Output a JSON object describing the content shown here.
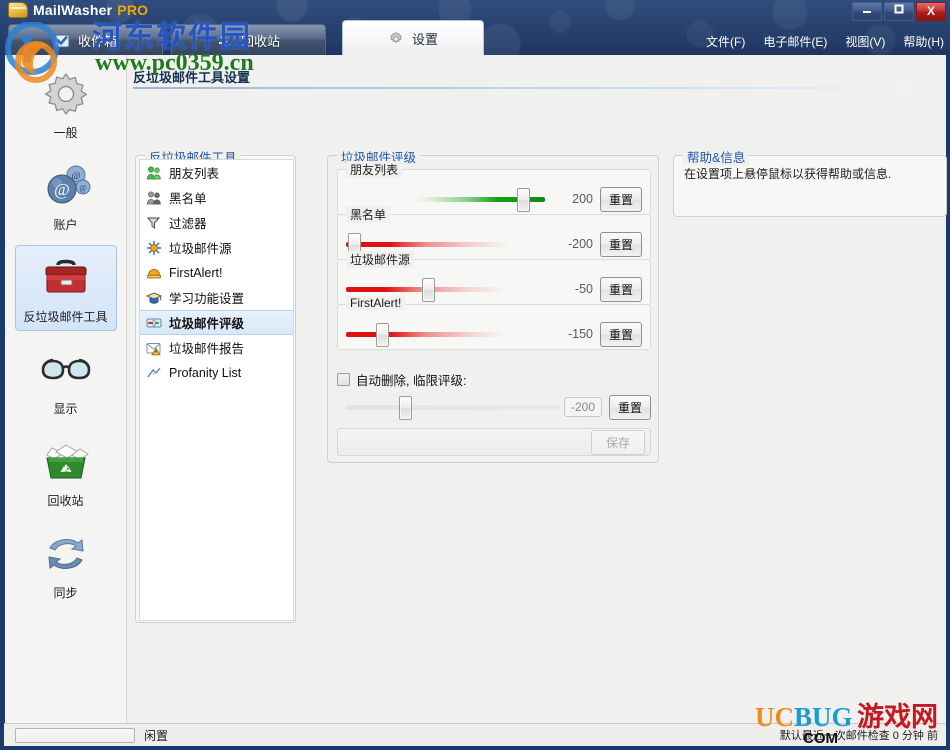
{
  "window": {
    "brand_main": "MailWasher",
    "brand_suffix": "PRO",
    "controls": {
      "minimize": "–",
      "maximize": "☐",
      "close": "X"
    }
  },
  "menubar": [
    {
      "label": "文件(F)",
      "name": "menu-file"
    },
    {
      "label": "电子邮件(E)",
      "name": "menu-email"
    },
    {
      "label": "视图(V)",
      "name": "menu-view"
    },
    {
      "label": "帮助(H)",
      "name": "menu-help"
    }
  ],
  "tabs": [
    {
      "label": "收件箱",
      "icon": "inbox-check-icon",
      "active": false
    },
    {
      "label": "回收站",
      "icon": "recycle-icon",
      "active": false
    },
    {
      "label": "设置",
      "icon": "gear-icon",
      "active": true
    }
  ],
  "sidebar": {
    "items": [
      {
        "label": "一般",
        "icon": "gear-icon",
        "selected": false
      },
      {
        "label": "账户",
        "icon": "at-spheres-icon",
        "selected": false
      },
      {
        "label": "反垃圾邮件工具",
        "icon": "toolbox-icon",
        "selected": true
      },
      {
        "label": "显示",
        "icon": "glasses-icon",
        "selected": false
      },
      {
        "label": "回收站",
        "icon": "recycle-bin-icon",
        "selected": false
      },
      {
        "label": "同步",
        "icon": "sync-icon",
        "selected": false
      }
    ]
  },
  "page": {
    "title": "反垃圾邮件工具设置"
  },
  "tools_group": {
    "legend": "反垃圾邮件工具",
    "items": [
      {
        "label": "朋友列表",
        "icon": "friends-green-icon",
        "selected": false
      },
      {
        "label": "黑名单",
        "icon": "blacklist-gray-icon",
        "selected": false
      },
      {
        "label": "过滤器",
        "icon": "funnel-icon",
        "selected": false
      },
      {
        "label": "垃圾邮件源",
        "icon": "spam-source-icon",
        "selected": false
      },
      {
        "label": "FirstAlert!",
        "icon": "firstalert-icon",
        "selected": false
      },
      {
        "label": "学习功能设置",
        "icon": "graduation-icon",
        "selected": false
      },
      {
        "label": "垃圾邮件评级",
        "icon": "rating-icon",
        "selected": true
      },
      {
        "label": "垃圾邮件报告",
        "icon": "mail-warning-icon",
        "selected": false
      },
      {
        "label": "Profanity List",
        "icon": "profanity-icon",
        "selected": false
      }
    ]
  },
  "rating_group": {
    "legend": "垃圾邮件评级",
    "reset_label": "重置",
    "sliders": [
      {
        "label": "朋友列表",
        "value": "200",
        "fill": "green",
        "pos_pct": 86
      },
      {
        "label": "黑名单",
        "value": "-200",
        "fill": "red",
        "pos_pct": 2
      },
      {
        "label": "垃圾邮件源",
        "value": "-50",
        "fill": "red",
        "pos_pct": 38
      },
      {
        "label": "FirstAlert!",
        "value": "-150",
        "fill": "red",
        "pos_pct": 15
      }
    ],
    "autodelete": {
      "label": "自动删除, 临限评级:",
      "checked": false,
      "value": "-200",
      "pos_pct": 25,
      "reset_label": "重置"
    },
    "save_label": "保存"
  },
  "help_group": {
    "legend": "帮助&信息",
    "text": "在设置项上悬停鼠标以获得帮助或信息."
  },
  "statusbar": {
    "status": "闲置",
    "right_text": "默认最近一次邮件检查 0 分钟 前"
  },
  "watermarks": {
    "hedong": "河东软件园",
    "url": "www.pc0359.cn",
    "ucbug_uc": "UC",
    "ucbug_bug": "BUG",
    "ucbug_cn": "游戏网",
    "ucbug_com": "COM"
  },
  "colors": {
    "titlebar": "#27416d",
    "accent": "#2255a8",
    "green": "#17a017",
    "red": "#e01010"
  }
}
